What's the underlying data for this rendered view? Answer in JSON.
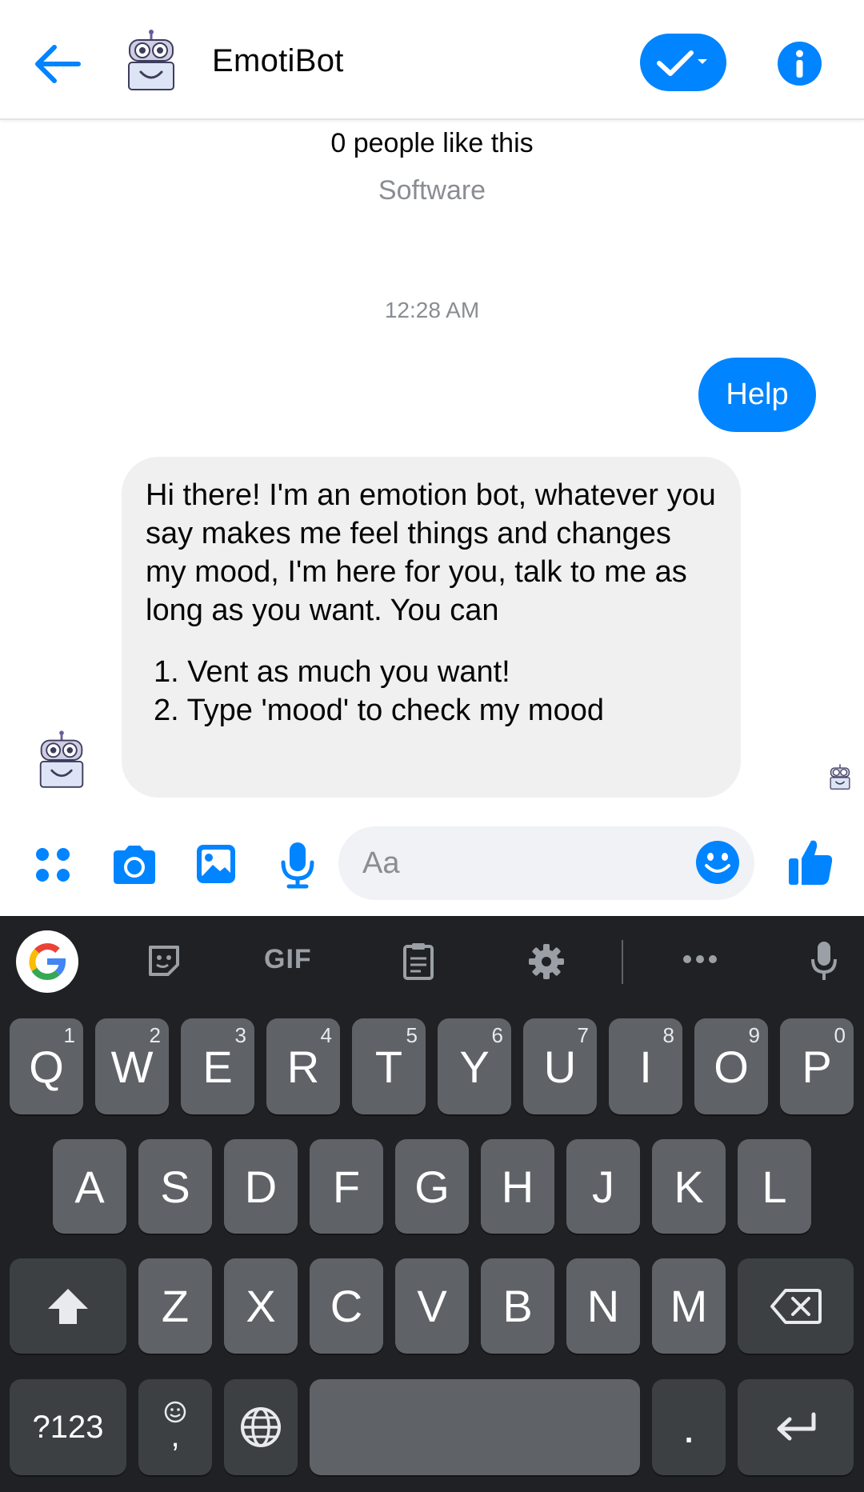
{
  "header": {
    "back_icon": "arrow-left-icon",
    "title": "EmotiBot",
    "status_icon": "check-dropdown-icon",
    "info_icon": "info-icon",
    "accent": "#0084ff"
  },
  "chat": {
    "likes": "0 people like this",
    "category": "Software",
    "timestamp": "12:28 AM",
    "messages": [
      {
        "from": "me",
        "text": "Help"
      },
      {
        "from": "bot",
        "intro": "Hi there! I'm an emotion bot, whatever you say makes me feel things and changes my mood, I'm here for you, talk to me as long as you want. You can",
        "items": [
          "1. Vent as much you want!",
          "2. Type 'mood' to check my mood"
        ]
      }
    ]
  },
  "composer": {
    "placeholder": "Aa",
    "icons": [
      "apps-icon",
      "camera-icon",
      "gallery-icon",
      "microphone-icon",
      "emoji-icon",
      "thumbs-up-icon"
    ]
  },
  "keyboard": {
    "toolbar": [
      "google-icon",
      "sticker-icon",
      "gif-icon",
      "clipboard-icon",
      "settings-icon",
      "more-icon",
      "voice-icon"
    ],
    "gif_label": "GIF",
    "row1": [
      {
        "k": "Q",
        "h": "1"
      },
      {
        "k": "W",
        "h": "2"
      },
      {
        "k": "E",
        "h": "3"
      },
      {
        "k": "R",
        "h": "4"
      },
      {
        "k": "T",
        "h": "5"
      },
      {
        "k": "Y",
        "h": "6"
      },
      {
        "k": "U",
        "h": "7"
      },
      {
        "k": "I",
        "h": "8"
      },
      {
        "k": "O",
        "h": "9"
      },
      {
        "k": "P",
        "h": "0"
      }
    ],
    "row2": [
      "A",
      "S",
      "D",
      "F",
      "G",
      "H",
      "J",
      "K",
      "L"
    ],
    "row3": [
      "Z",
      "X",
      "C",
      "V",
      "B",
      "N",
      "M"
    ],
    "symbols_label": "?123",
    "comma_label": ",",
    "period_label": "."
  }
}
